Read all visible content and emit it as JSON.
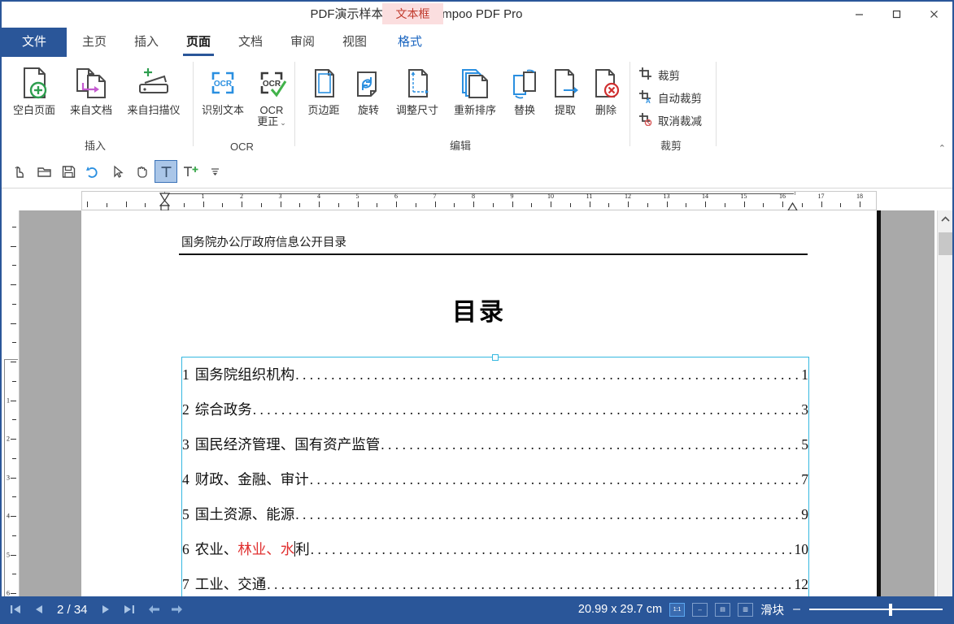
{
  "window": {
    "title": "PDF演示样本.pdf - Ashampoo PDF Pro",
    "floating_tab": "文本框",
    "minimize": "minimize",
    "maximize": "maximize",
    "close": "close"
  },
  "menu": {
    "tabs": [
      {
        "label": "文件",
        "state": "file"
      },
      {
        "label": "主页",
        "state": "normal"
      },
      {
        "label": "插入",
        "state": "normal"
      },
      {
        "label": "页面",
        "state": "active"
      },
      {
        "label": "文档",
        "state": "normal"
      },
      {
        "label": "审阅",
        "state": "normal"
      },
      {
        "label": "视图",
        "state": "normal"
      },
      {
        "label": "格式",
        "state": "blue"
      }
    ],
    "help": "?",
    "chevron": "⌄"
  },
  "ribbon": {
    "groups": [
      {
        "name": "插入",
        "buttons": [
          {
            "label": "空白页面",
            "icon": "page-add-icon"
          },
          {
            "label": "来自文档",
            "icon": "page-from-document-icon"
          },
          {
            "label": "来自扫描仪",
            "icon": "scanner-icon"
          }
        ]
      },
      {
        "name": "OCR",
        "buttons": [
          {
            "label": "识别文本",
            "icon": "ocr-recognize-icon"
          },
          {
            "label": "OCR",
            "label2": "更正",
            "icon": "ocr-correct-icon",
            "has_dropdown": true
          }
        ]
      },
      {
        "name": "编辑",
        "buttons": [
          {
            "label": "页边距",
            "icon": "page-margins-icon"
          },
          {
            "label": "旋转",
            "icon": "rotate-icon"
          },
          {
            "label": "调整尺寸",
            "icon": "resize-icon"
          },
          {
            "label": "重新排序",
            "icon": "reorder-icon"
          },
          {
            "label": "替换",
            "icon": "replace-icon"
          },
          {
            "label": "提取",
            "icon": "extract-icon"
          },
          {
            "label": "删除",
            "icon": "delete-icon"
          }
        ]
      },
      {
        "name": "裁剪",
        "buttons": [
          {
            "label": "裁剪",
            "icon": "crop-icon"
          },
          {
            "label": "自动裁剪",
            "icon": "auto-crop-icon"
          },
          {
            "label": "取消裁减",
            "icon": "uncrop-icon"
          }
        ]
      }
    ],
    "collapse": "⌃"
  },
  "toolbar": {
    "buttons": [
      {
        "name": "touch-mode-icon",
        "selected": false
      },
      {
        "name": "open-folder-icon",
        "selected": false
      },
      {
        "name": "save-icon",
        "selected": false
      },
      {
        "name": "undo-icon",
        "selected": false
      },
      {
        "name": "select-arrow-icon",
        "selected": false
      },
      {
        "name": "pan-hand-icon",
        "selected": false
      },
      {
        "name": "text-tool-icon",
        "selected": true
      },
      {
        "name": "add-text-icon",
        "selected": false
      },
      {
        "name": "more-tools-icon",
        "selected": false
      }
    ]
  },
  "rulers": {
    "horizontal_numbers": [
      1,
      2,
      3,
      4,
      5,
      6,
      7,
      8,
      9,
      10,
      11,
      12,
      13,
      14,
      15,
      16,
      17,
      18
    ],
    "vertical_numbers": [
      1,
      2,
      3,
      4,
      5,
      6
    ],
    "unit": "cm"
  },
  "document": {
    "header": "国务院办公厅政府信息公开目录",
    "title": "目录",
    "toc": [
      {
        "num": "1",
        "title": "国务院组织机构",
        "page": "1"
      },
      {
        "num": "2",
        "title": "综合政务",
        "page": "3"
      },
      {
        "num": "3",
        "title": "国民经济管理、国有资产监管",
        "page": "5"
      },
      {
        "num": "4",
        "title": "财政、金融、审计",
        "page": "7"
      },
      {
        "num": "5",
        "title": "国土资源、能源",
        "page": "9"
      },
      {
        "num": "6",
        "title_pre": "农业、",
        "title_red": "林业、水",
        "title_post": "利",
        "page": "10",
        "has_caret": true
      },
      {
        "num": "7",
        "title": "工业、交通",
        "page": "12"
      }
    ]
  },
  "status": {
    "first_page": "first-page",
    "prev_page": "previous-page",
    "page_indicator": "2 / 34",
    "next_page": "next-page",
    "last_page": "last-page",
    "back": "back",
    "forward": "forward",
    "dimensions": "20.99 x 29.7 cm",
    "view_modes": [
      {
        "name": "actual-size",
        "glyph": "1:1",
        "selected": true
      },
      {
        "name": "fit-width",
        "glyph": "↔",
        "selected": false
      },
      {
        "name": "single-page",
        "glyph": "▤",
        "selected": false
      },
      {
        "name": "continuous-page",
        "glyph": "▥",
        "selected": false
      }
    ],
    "zoom_label": "滑块",
    "zoom_minus": "–"
  },
  "colors": {
    "accent": "#2a5699",
    "tab_highlight": "#fbdedf",
    "tab_text": "#c0392b",
    "selection": "#35b8e0",
    "red_text": "#e03030"
  }
}
